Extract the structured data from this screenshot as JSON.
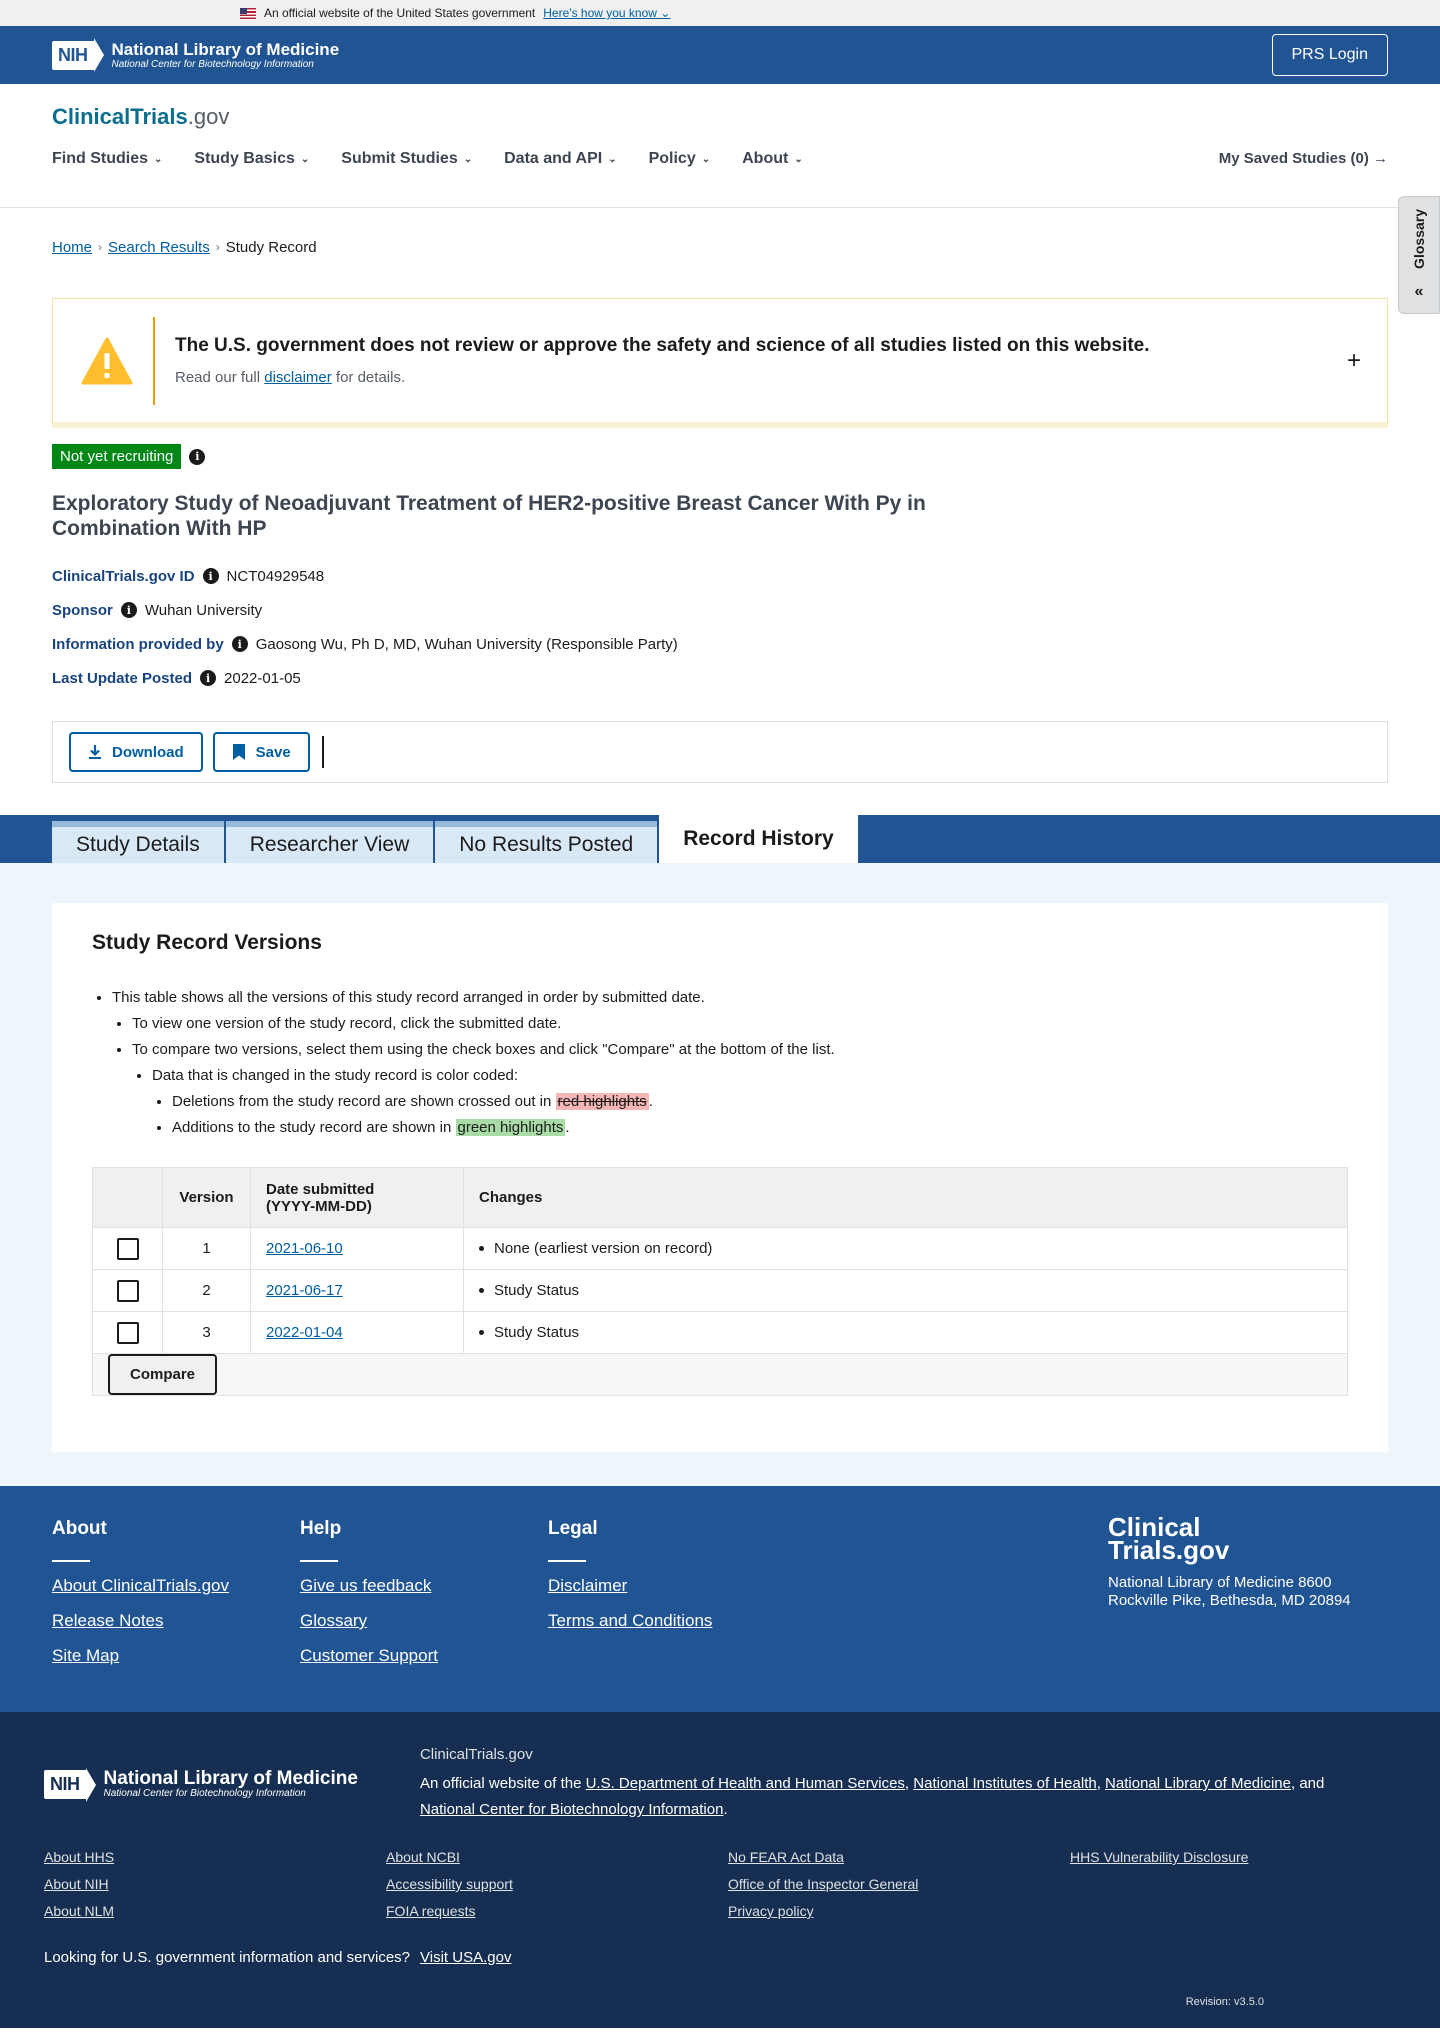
{
  "gov_banner": {
    "text": "An official website of the United States government",
    "link": "Here's how you know"
  },
  "nlm": {
    "nih": "NIH",
    "title": "National Library of Medicine",
    "subtitle": "National Center for Biotechnology Information",
    "prs_login": "PRS Login"
  },
  "site": {
    "logo_main": "ClinicalTrials",
    "logo_gov": ".gov"
  },
  "nav": {
    "items": [
      "Find Studies",
      "Study Basics",
      "Submit Studies",
      "Data and API",
      "Policy",
      "About"
    ],
    "saved": "My Saved Studies (0)"
  },
  "breadcrumb": {
    "home": "Home",
    "search": "Search Results",
    "current": "Study Record"
  },
  "glossary": {
    "label": "Glossary"
  },
  "disclaimer": {
    "title": "The U.S. government does not review or approve the safety and science of all studies listed on this website.",
    "pre": "Read our full",
    "link": "disclaimer",
    "post": "for details."
  },
  "status": {
    "badge": "Not yet recruiting"
  },
  "study": {
    "title": "Exploratory Study of Neoadjuvant Treatment of HER2-positive Breast Cancer With Py in Combination With HP",
    "meta": [
      {
        "label": "ClinicalTrials.gov ID",
        "value": "NCT04929548"
      },
      {
        "label": "Sponsor",
        "value": "Wuhan University"
      },
      {
        "label": "Information provided by",
        "value": "Gaosong Wu, Ph D, MD, Wuhan University (Responsible Party)"
      },
      {
        "label": "Last Update Posted",
        "value": "2022-01-05"
      }
    ]
  },
  "actions": {
    "download": "Download",
    "save": "Save"
  },
  "tabs": [
    "Study Details",
    "Researcher View",
    "No Results Posted",
    "Record History"
  ],
  "versions": {
    "title": "Study Record Versions",
    "b1": "This table shows all the versions of this study record arranged in order by submitted date.",
    "b2": "To view one version of the study record, click the submitted date.",
    "b3": "To compare two versions, select them using the check boxes and click \"Compare\" at the bottom of the list.",
    "b4": "Data that is changed in the study record is color coded:",
    "b5_pre": "Deletions from the study record are shown crossed out in",
    "b5_hl": "red highlights",
    "b6_pre": "Additions to the study record are shown in",
    "b6_hl": "green highlights",
    "dot": ".",
    "headers": {
      "version": "Version",
      "date": "Date submitted",
      "date_fmt": "(YYYY-MM-DD)",
      "changes": "Changes"
    },
    "rows": [
      {
        "version": "1",
        "date": "2021-06-10",
        "change": "None (earliest version on record)"
      },
      {
        "version": "2",
        "date": "2021-06-17",
        "change": "Study Status"
      },
      {
        "version": "3",
        "date": "2022-01-04",
        "change": "Study Status"
      }
    ],
    "compare": "Compare"
  },
  "footer": {
    "about": {
      "title": "About",
      "links": [
        "About ClinicalTrials.gov",
        "Release Notes",
        "Site Map"
      ]
    },
    "help": {
      "title": "Help",
      "links": [
        "Give us feedback",
        "Glossary",
        "Customer Support"
      ]
    },
    "legal": {
      "title": "Legal",
      "links": [
        "Disclaimer",
        "Terms and Conditions"
      ]
    },
    "brand_line1": "Clinical",
    "brand_line2": "Trials.gov",
    "address": "National Library of Medicine 8600 Rockville Pike, Bethesda, MD 20894"
  },
  "footer_bottom": {
    "site": "ClinicalTrials.gov",
    "official_pre": "An official website of the",
    "hhs": "U.S. Department of Health and Human Services",
    "nih": "National Institutes of Health",
    "nlm": "National Library of Medicine",
    "and": ", and",
    "ncbi": "National Center for Biotechnology Information",
    "links": [
      "About HHS",
      "About NCBI",
      "No FEAR Act Data",
      "HHS Vulnerability Disclosure",
      "About NIH",
      "Accessibility support",
      "Office of the Inspector General",
      "",
      "About NLM",
      "FOIA requests",
      "Privacy policy",
      ""
    ],
    "gov_q": "Looking for U.S. government information and services?",
    "usa": "Visit USA.gov",
    "revision": "Revision: v3.5.0"
  },
  "colors": {
    "header_blue": "#205493",
    "footer_dark": "#162e51",
    "status_green": "#008817",
    "link": "#005ea2"
  }
}
